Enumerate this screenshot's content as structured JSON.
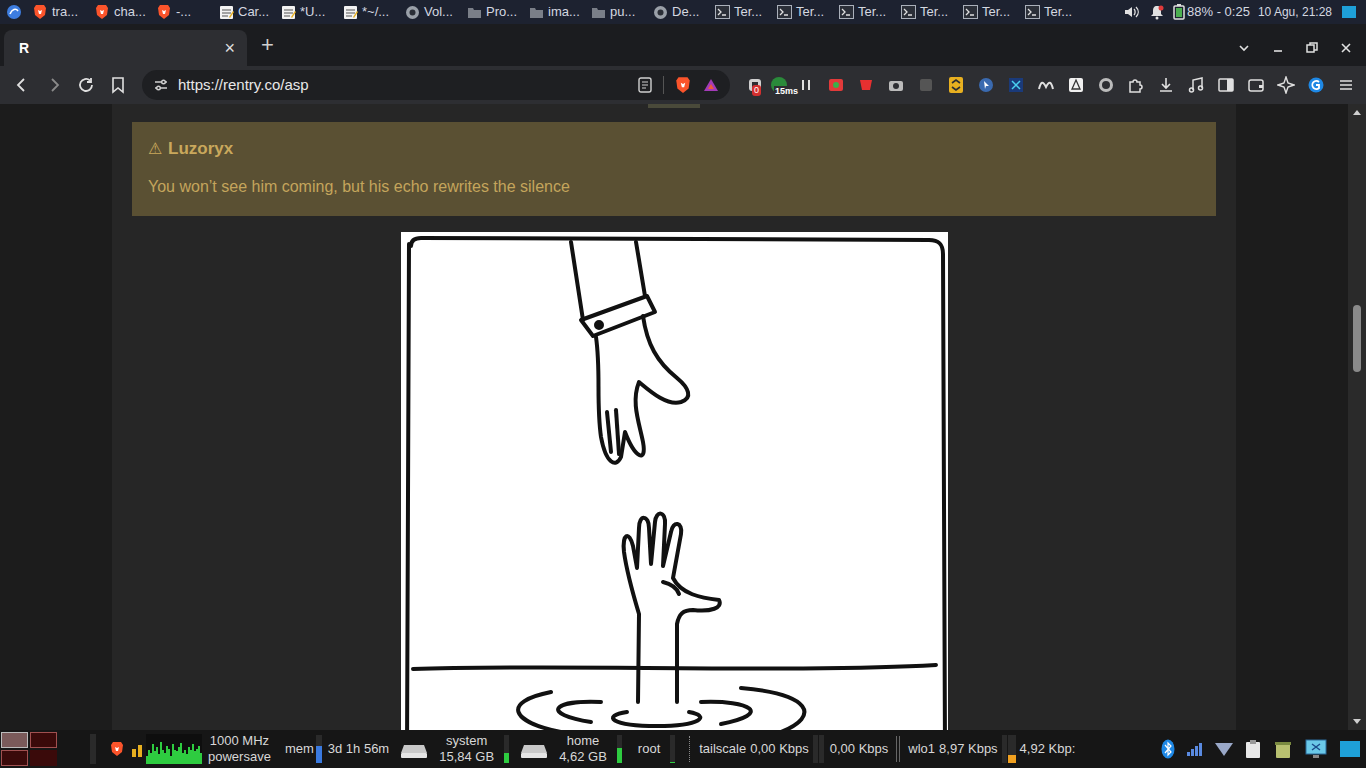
{
  "taskbar": {
    "tasks": [
      {
        "label": "tra...",
        "kind": "brave",
        "selected": false
      },
      {
        "label": "cha...",
        "kind": "brave",
        "selected": false
      },
      {
        "label": "-...",
        "kind": "brave",
        "selected": false
      },
      {
        "label": "Car...",
        "kind": "note",
        "selected": false
      },
      {
        "label": "*U...",
        "kind": "note",
        "selected": false
      },
      {
        "label": "*~/...",
        "kind": "note",
        "selected": false
      },
      {
        "label": "Vol...",
        "kind": "app",
        "selected": false
      },
      {
        "label": "Pro...",
        "kind": "folder",
        "selected": false
      },
      {
        "label": "ima...",
        "kind": "folder",
        "selected": false
      },
      {
        "label": "pu...",
        "kind": "folder",
        "selected": false
      },
      {
        "label": "De...",
        "kind": "app",
        "selected": false
      },
      {
        "label": "Ter...",
        "kind": "terminal",
        "selected": false
      },
      {
        "label": "Ter...",
        "kind": "terminal",
        "selected": false
      },
      {
        "label": "Ter...",
        "kind": "terminal",
        "selected": false
      },
      {
        "label": "Ter...",
        "kind": "terminal",
        "selected": false
      },
      {
        "label": "Ter...",
        "kind": "terminal",
        "selected": false
      },
      {
        "label": "Ter...",
        "kind": "terminal",
        "selected": false
      }
    ],
    "battery": "88% - 0:25",
    "clock": "10 Agu, 21:28"
  },
  "browser": {
    "tab": {
      "icon": "R",
      "close": "×",
      "selected": true
    },
    "new_tab": "+",
    "url": "https://rentry.co/asp",
    "badges": [
      "0",
      "15ms"
    ]
  },
  "page": {
    "admonition": {
      "icon": "⚠",
      "title": "Luzoryx",
      "text": "You won’t see him coming, but his echo rewrites the silence"
    }
  },
  "status_bar": {
    "cpu": {
      "history": [
        0.3,
        0.5,
        0.4,
        0.7,
        0.45,
        0.6,
        0.35,
        0.8,
        0.5,
        0.4,
        0.65,
        0.55,
        0.3,
        0.7,
        0.5,
        0.45,
        0.6,
        0.75,
        0.4,
        0.5,
        0.35,
        0.6,
        0.5,
        0.7,
        0.45,
        0.55,
        0.65,
        0.4
      ],
      "frequency": "1000 MHz",
      "governor": "powersave"
    },
    "mem": {
      "label": "mem",
      "level": 0.6
    },
    "uptime": "3d 1h 56m",
    "disks": [
      {
        "name": "system",
        "free": "15,84 GB",
        "level": 0.35
      },
      {
        "name": "home",
        "free": "4,62 GB",
        "level": 0.55
      },
      {
        "name": "root",
        "free": "",
        "level": 0.05
      }
    ],
    "tailscale": {
      "label": "tailscale",
      "rate": "0,00 Kbps"
    },
    "tailscale_up": "0,00 Kbps",
    "wifi": {
      "label": "wlo1",
      "rate": "8,97 Kbps"
    },
    "wifi_up": "4,92 Kbp:"
  }
}
